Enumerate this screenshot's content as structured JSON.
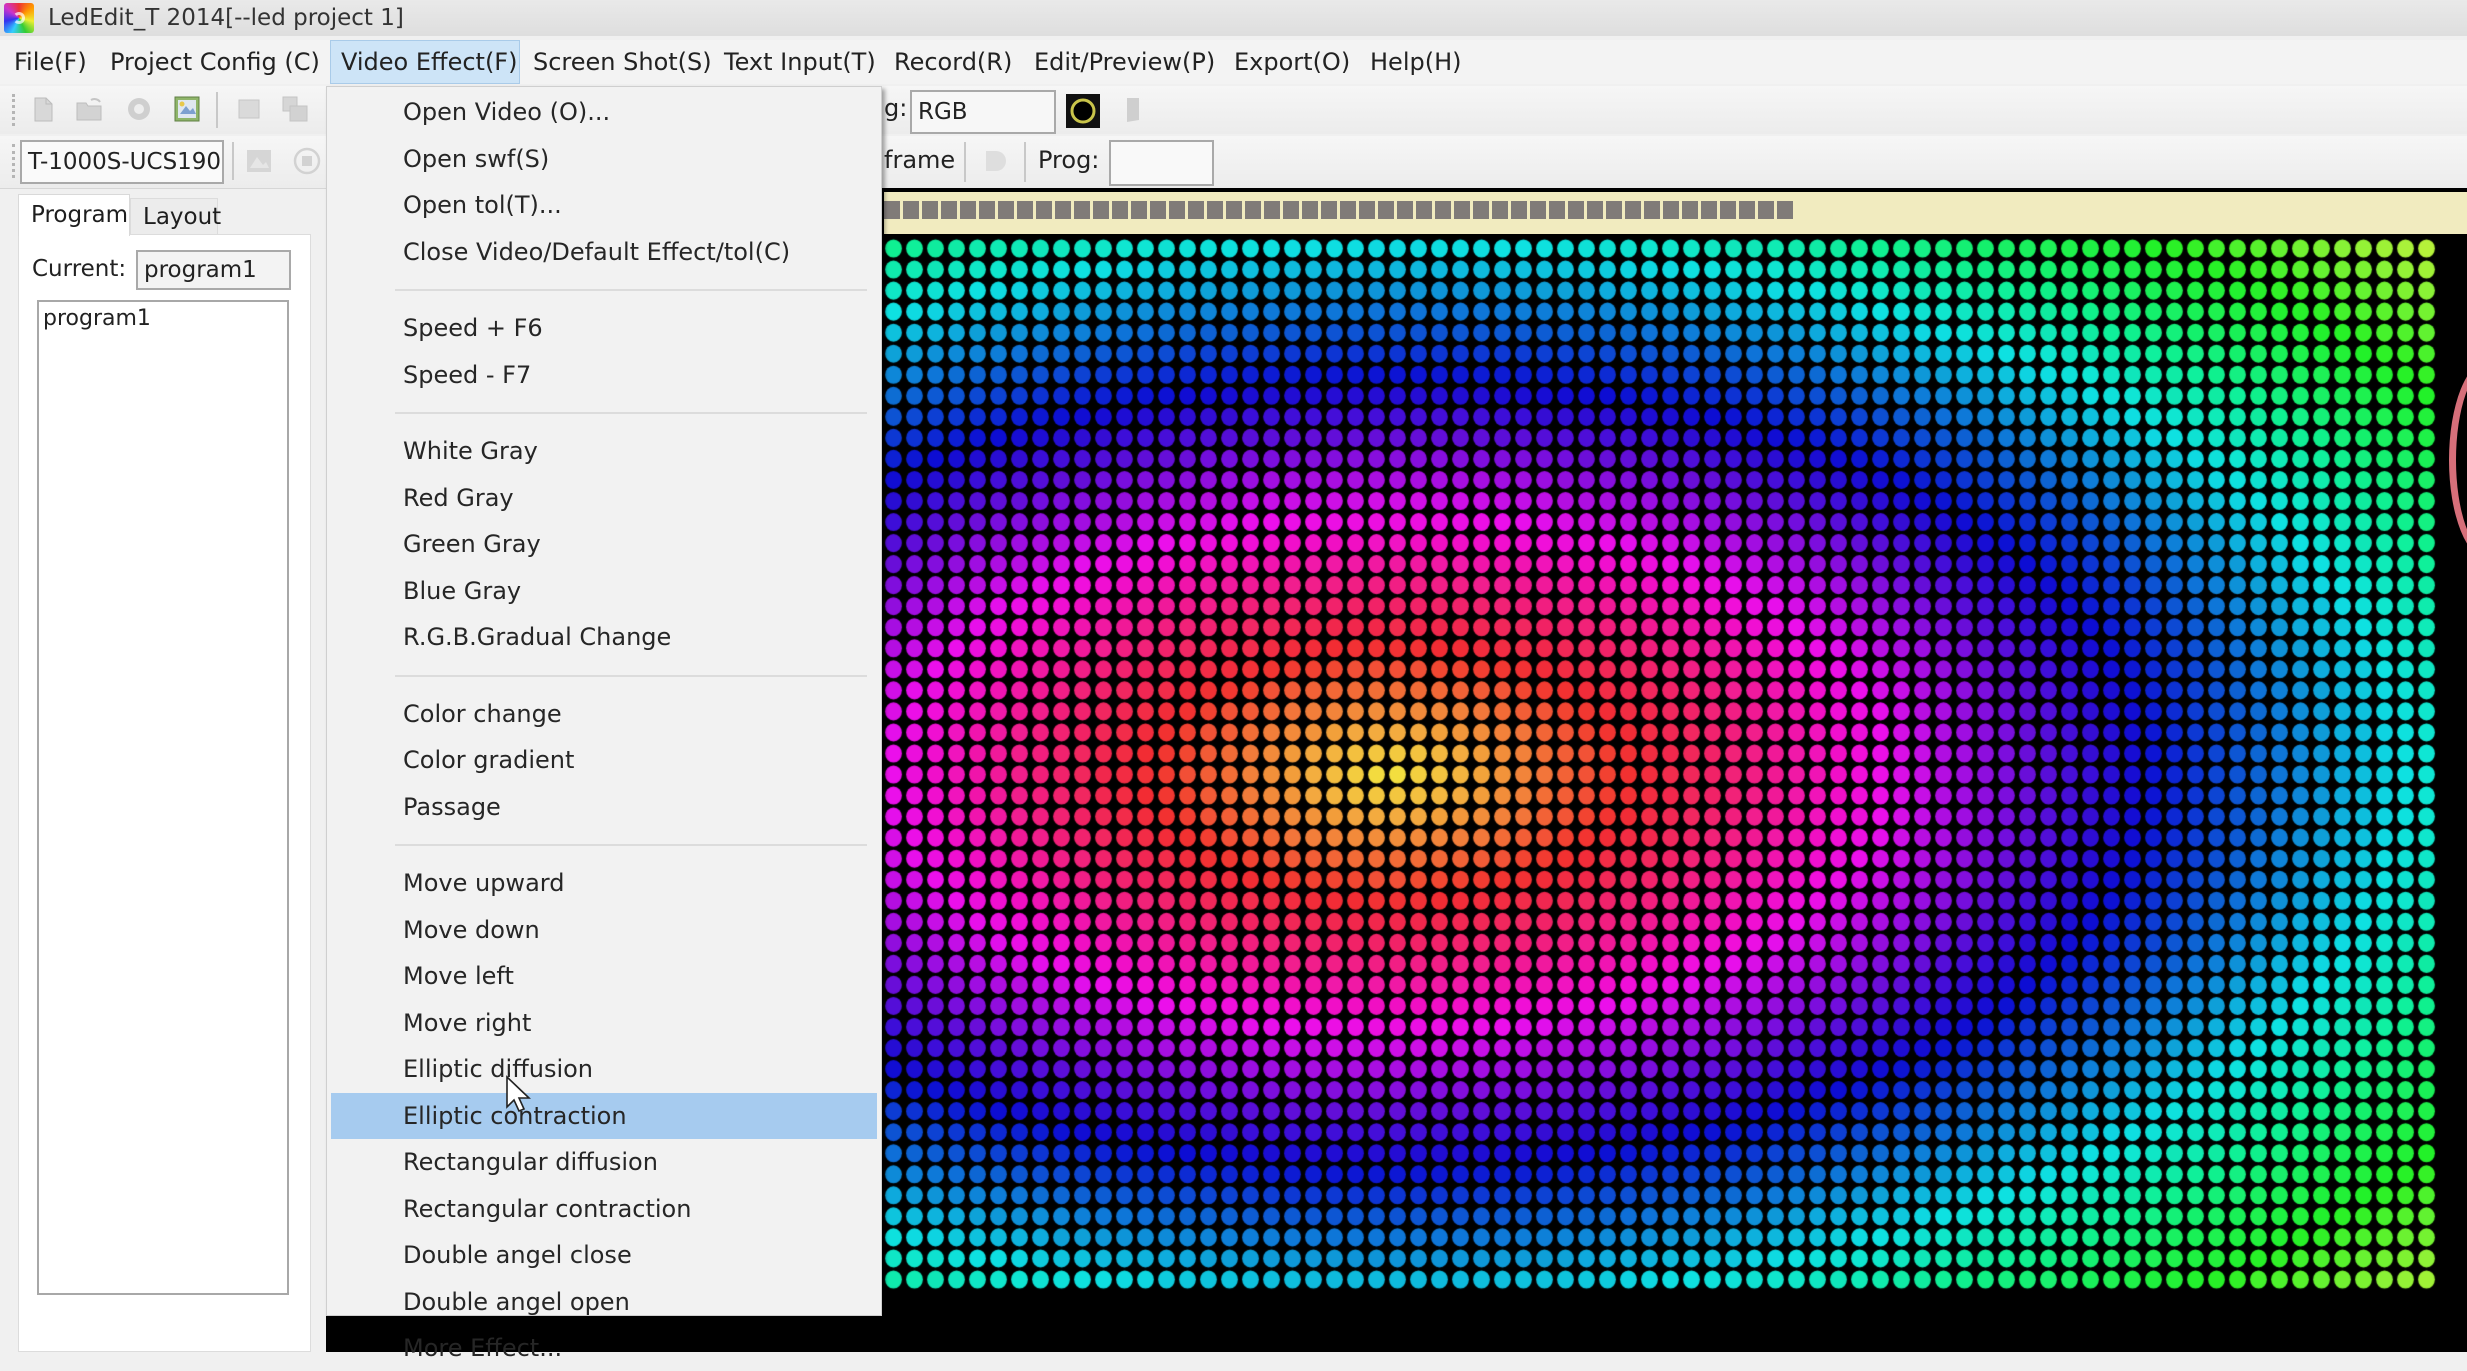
{
  "window": {
    "title": "LedEdit_T 2014[--led project 1]"
  },
  "menubar": {
    "items": [
      {
        "label": "File(F)"
      },
      {
        "label": "Project Config (C)"
      },
      {
        "label": "Video Effect(F)"
      },
      {
        "label": "Screen Shot(S)"
      },
      {
        "label": "Text Input(T)"
      },
      {
        "label": "Record(R)"
      },
      {
        "label": "Edit/Preview(P)"
      },
      {
        "label": "Export(O)"
      },
      {
        "label": "Help(H)"
      }
    ],
    "active_index": 2
  },
  "toolbar": {
    "icons": [
      "new-file-icon",
      "open-folder-icon",
      "settings-gear-icon",
      "image-icon",
      "window-icon",
      "copy-icon"
    ],
    "controller_value": "T-1000S-UCS190",
    "color_mode_label": "g:",
    "color_mode_value": "RGB",
    "frame_label": "frame",
    "prog_label": "Prog:",
    "prog_value": "",
    "slider_value_fraction": 0.88
  },
  "left_panel": {
    "tabs": [
      {
        "label": "Program",
        "selected": true
      },
      {
        "label": "Layout",
        "selected": false
      }
    ],
    "current_label": "Current:",
    "current_value": "program1",
    "programs": [
      "program1"
    ]
  },
  "preview": {
    "progress_fraction": 0.58,
    "effect": "Elliptic contraction",
    "led_columns": 74,
    "led_rows": 50
  },
  "dropdown": {
    "groups": [
      [
        "Open Video (O)...",
        "Open swf(S)",
        "Open tol(T)...",
        "Close Video/Default Effect/tol(C)"
      ],
      [
        "Speed +  F6",
        "Speed -  F7"
      ],
      [
        "White Gray",
        "Red Gray",
        "Green Gray",
        "Blue Gray",
        "R.G.B.Gradual Change"
      ],
      [
        "Color change",
        "Color gradient",
        "Passage"
      ],
      [
        "Move upward",
        "Move down",
        "Move left",
        "Move right",
        "Elliptic diffusion",
        "Elliptic contraction",
        "Rectangular diffusion",
        "Rectangular contraction",
        "Double angel close",
        "Double angel open",
        "More Effect..."
      ]
    ],
    "highlighted": "Elliptic contraction"
  }
}
